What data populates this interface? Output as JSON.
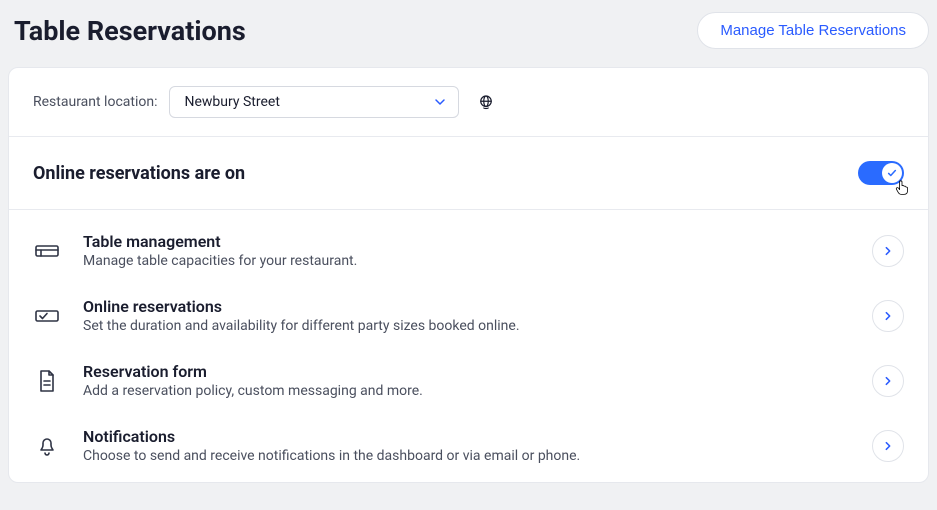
{
  "header": {
    "title": "Table Reservations",
    "manage_button": "Manage Table Reservations"
  },
  "location": {
    "label": "Restaurant location:",
    "value": "Newbury Street"
  },
  "toggle": {
    "label": "Online reservations are on",
    "on": true
  },
  "settings": [
    {
      "icon": "table",
      "title": "Table management",
      "desc": "Manage table capacities for your restaurant."
    },
    {
      "icon": "online",
      "title": "Online reservations",
      "desc": "Set the duration and availability for different party sizes booked online."
    },
    {
      "icon": "form",
      "title": "Reservation form",
      "desc": "Add a reservation policy, custom messaging and more."
    },
    {
      "icon": "bell",
      "title": "Notifications",
      "desc": "Choose to send and receive notifications in the dashboard or via email or phone."
    }
  ]
}
